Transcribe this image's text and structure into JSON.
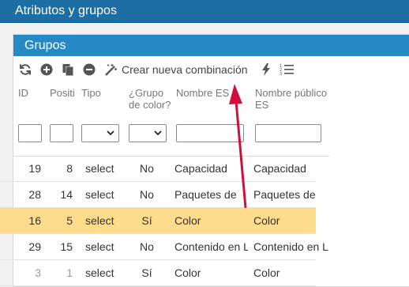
{
  "app": {
    "title": "Atributos y grupos"
  },
  "panel": {
    "title": "Grupos"
  },
  "toolbar": {
    "create_combination_label": "Crear nueva combinación"
  },
  "table": {
    "headers": {
      "id": "ID",
      "position": "Positi",
      "type": "Tipo",
      "color_group_line1": "¿Grupo",
      "color_group_line2": "de color?",
      "name_es": "Nombre ES",
      "public_name_line1": "Nombre público",
      "public_name_line2": "ES"
    },
    "rows": [
      {
        "id": "19",
        "position": "8",
        "type": "select",
        "color_group": "No",
        "name": "Capacidad",
        "public_name": "Capacidad"
      },
      {
        "id": "28",
        "position": "14",
        "type": "select",
        "color_group": "No",
        "name": "Paquetes de",
        "public_name": "Paquetes de"
      },
      {
        "id": "16",
        "position": "5",
        "type": "select",
        "color_group": "Sí",
        "name": "Color",
        "public_name": "Color"
      },
      {
        "id": "29",
        "position": "15",
        "type": "select",
        "color_group": "No",
        "name": "Contenido en L",
        "public_name": "Contenido en L"
      },
      {
        "id": "3",
        "position": "1",
        "type": "select",
        "color_group": "Sí",
        "name": "Color",
        "public_name": "Color"
      }
    ]
  },
  "colors": {
    "header": "#1c6ea4",
    "panel_header": "#2489c5",
    "selected_row": "#fedc8b",
    "annotation_arrow": "#d0103a"
  }
}
